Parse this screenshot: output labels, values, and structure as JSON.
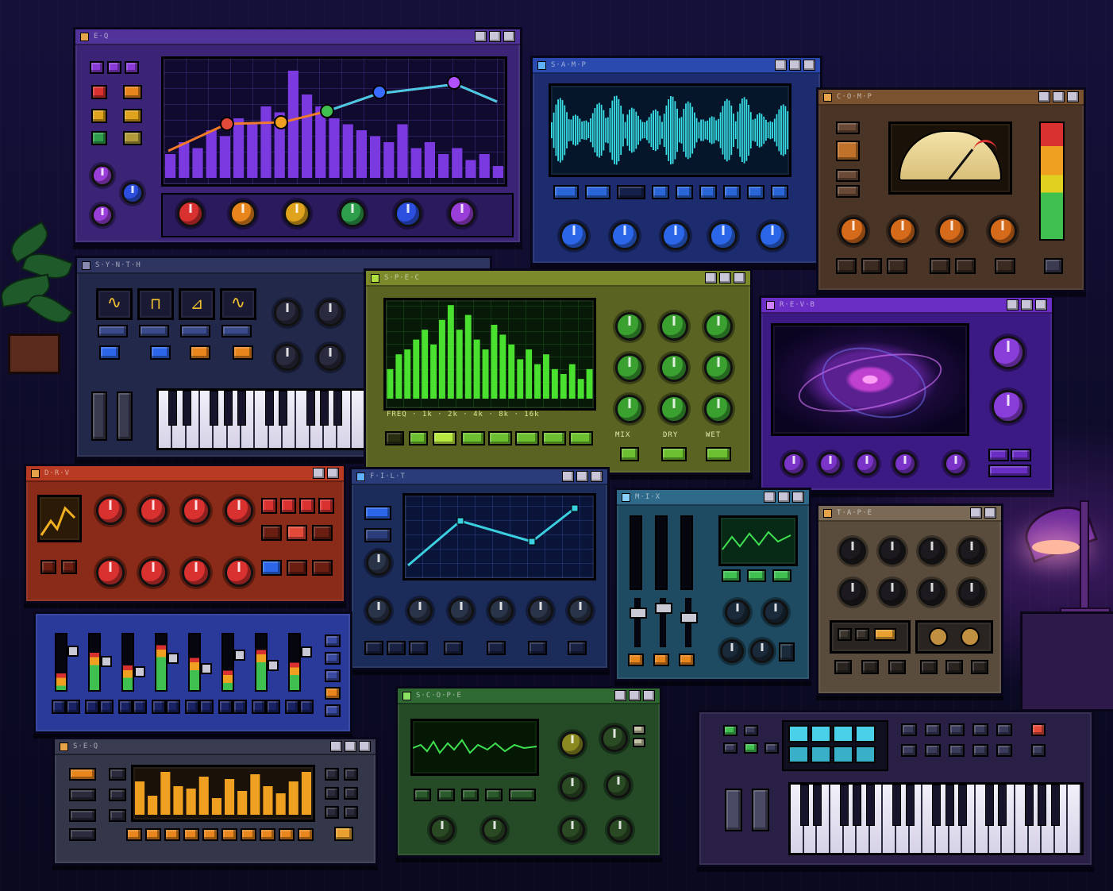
{
  "scene": {
    "title": "Retro DAW Plugin Collage"
  },
  "windows": [
    {
      "id": "eq",
      "title": "E·Q",
      "accent": "#7a3fd1"
    },
    {
      "id": "wave",
      "title": "S·A·M·P",
      "accent": "#2a55c4"
    },
    {
      "id": "vu",
      "title": "C·O·M·P",
      "accent": "#b07a3d"
    },
    {
      "id": "synth",
      "title": "S·Y·N·T·H",
      "accent": "#2d3560"
    },
    {
      "id": "spectrum",
      "title": "S·P·E·C",
      "accent": "#7d8a2c"
    },
    {
      "id": "galaxy",
      "title": "R·E·V·B",
      "accent": "#6a2ec4"
    },
    {
      "id": "redpanel",
      "title": "D·R·V",
      "accent": "#b83a22"
    },
    {
      "id": "curve",
      "title": "F·I·L·T",
      "accent": "#2a3c7a"
    },
    {
      "id": "mixer",
      "title": "M·I·X",
      "accent": "#2f6a8a"
    },
    {
      "id": "tape",
      "title": "T·A·P·E",
      "accent": "#7a6a55"
    },
    {
      "id": "channels",
      "title": "",
      "accent": "#2a3a9a"
    },
    {
      "id": "seq",
      "title": "S·E·Q",
      "accent": "#3a3c52"
    },
    {
      "id": "greenscope",
      "title": "S·C·O·P·E",
      "accent": "#2f6a33"
    },
    {
      "id": "keyboard",
      "title": "",
      "accent": "#3a2e5c"
    }
  ],
  "spectrum_labels": {
    "footer": "FREQ · 1k · 2k · 4k · 8k · 16k",
    "knob_row_labels": [
      "MIX",
      "DRY",
      "WET"
    ]
  },
  "eq_curve_points": [
    {
      "band": 1,
      "color": "#e34a3a"
    },
    {
      "band": 2,
      "color": "#f0a020"
    },
    {
      "band": 3,
      "color": "#3fbf4f"
    },
    {
      "band": 4,
      "color": "#3a6bff"
    },
    {
      "band": 5,
      "color": "#b050ff"
    }
  ],
  "knob_colors": {
    "eq": [
      "#d93030",
      "#e8861d",
      "#e0a31d",
      "#2e9e4c",
      "#2c4fe0",
      "#9a3ed9"
    ],
    "wave": [
      "#2c66e8",
      "#2c66e8",
      "#2c66e8",
      "#2c66e8",
      "#2c66e8"
    ],
    "comp": [
      "#d56a1b",
      "#d56a1b",
      "#d56a1b",
      "#d56a1b"
    ]
  },
  "seq_bars": [
    0.7,
    0.4,
    0.9,
    0.6,
    0.55,
    0.8,
    0.35,
    0.75,
    0.5,
    0.85,
    0.6,
    0.45,
    0.7,
    0.9
  ],
  "spectrum_bars": [
    0.3,
    0.45,
    0.5,
    0.6,
    0.7,
    0.55,
    0.8,
    0.95,
    0.7,
    0.85,
    0.6,
    0.5,
    0.75,
    0.65,
    0.55,
    0.4,
    0.5,
    0.35,
    0.45,
    0.3,
    0.25,
    0.35,
    0.2,
    0.3
  ],
  "eq_bars": [
    0.2,
    0.3,
    0.25,
    0.4,
    0.35,
    0.5,
    0.45,
    0.6,
    0.55,
    0.9,
    0.7,
    0.6,
    0.5,
    0.45,
    0.4,
    0.35,
    0.3,
    0.45,
    0.25,
    0.3,
    0.2,
    0.25,
    0.15,
    0.2,
    0.1
  ]
}
